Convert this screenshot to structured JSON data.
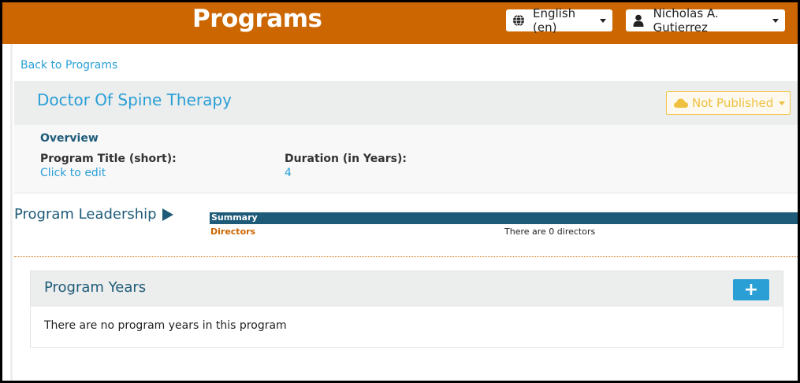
{
  "header": {
    "title": "Programs",
    "language_label": "English (en)",
    "language_icon": "globe-icon",
    "user_name": "Nicholas A. Gutierrez",
    "user_icon": "user-icon"
  },
  "nav": {
    "back_link": "Back to Programs"
  },
  "program": {
    "title": "Doctor Of Spine Therapy",
    "publish_status": "Not Published",
    "publish_icon": "cloud-icon"
  },
  "overview": {
    "heading": "Overview",
    "fields": [
      {
        "label": "Program Title (short):",
        "value": "Click to edit"
      },
      {
        "label": "Duration (in Years):",
        "value": "4"
      }
    ]
  },
  "leadership": {
    "title": "Program Leadership",
    "summary_label": "Summary",
    "directors_label": "Directors",
    "directors_value": "There are 0 directors"
  },
  "program_years": {
    "title": "Program Years",
    "add_label": "+",
    "empty_message": "There are no program years in this program"
  },
  "colors": {
    "header_bg": "#cc6600",
    "link": "#2a9fd6",
    "heading": "#1e5b79",
    "publish": "#f0c040"
  }
}
